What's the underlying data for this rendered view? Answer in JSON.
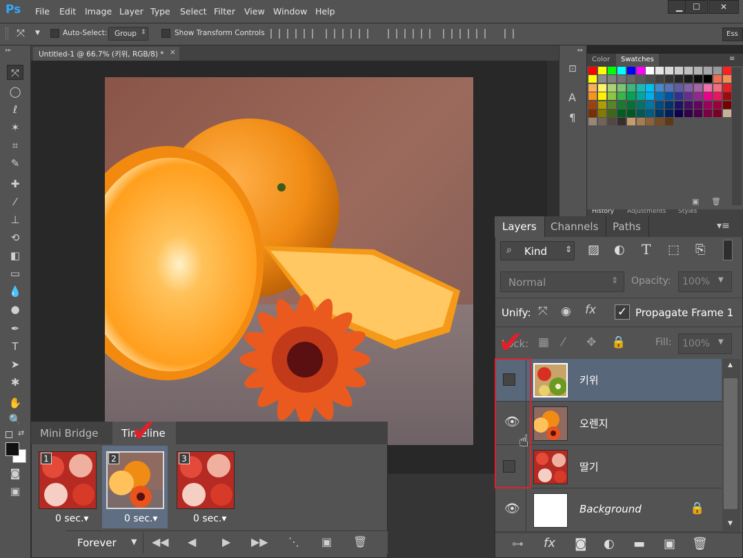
{
  "menubar": {
    "logo": "Ps",
    "items": [
      "File",
      "Edit",
      "Image",
      "Layer",
      "Type",
      "Select",
      "Filter",
      "View",
      "Window",
      "Help"
    ],
    "win_min": "▁",
    "win_max": "☐",
    "win_close": "✕"
  },
  "options": {
    "auto_select_label": "Auto-Select:",
    "auto_select_mode": "Group",
    "show_transform_label": "Show Transform Controls",
    "workspace": "Ess"
  },
  "document": {
    "tab_title": "Untitled-1 @ 66.7% (키위, RGB/8) *",
    "tab_close": "×"
  },
  "swatches": {
    "tabs": [
      "Color",
      "Swatches"
    ],
    "bottom_tabs": [
      "History",
      "Adjustments",
      "Styles"
    ],
    "colors": [
      "#ff0000",
      "#ffff00",
      "#00ff00",
      "#00ffff",
      "#0000ff",
      "#ff00ff",
      "#ffffff",
      "#e6e6e6",
      "#d9d9d9",
      "#cccccc",
      "#bfbfbf",
      "#b3b3b3",
      "#a6a6a6",
      "#999999",
      "#ff1f1f",
      "#ffff00",
      "#8c8c8c",
      "#808080",
      "#737373",
      "#666666",
      "#595959",
      "#4d4d4d",
      "#404040",
      "#333333",
      "#262626",
      "#1a1a1a",
      "#0d0d0d",
      "#000000",
      "#f26c4f",
      "#f68e55",
      "#fbaf5c",
      "#fff467",
      "#acd372",
      "#7cc576",
      "#3bb878",
      "#1abbb4",
      "#00bff3",
      "#438ccb",
      "#5574b9",
      "#605ca8",
      "#855fa8",
      "#a763a9",
      "#f06ea9",
      "#f26d7d",
      "#ed1c24",
      "#f7941d",
      "#fff200",
      "#8dc73f",
      "#39b54a",
      "#00a651",
      "#00a99d",
      "#00aeef",
      "#0072bc",
      "#0054a5",
      "#2e3192",
      "#662d91",
      "#92278f",
      "#ec008c",
      "#ed145b",
      "#9e0b0f",
      "#a0410d",
      "#aba000",
      "#598527",
      "#197b30",
      "#007236",
      "#00746b",
      "#0076a3",
      "#004b80",
      "#003471",
      "#1b1464",
      "#440e62",
      "#630460",
      "#9e005d",
      "#9e0039",
      "#790000",
      "#7b2e00",
      "#827b00",
      "#406618",
      "#005e20",
      "#005826",
      "#005952",
      "#005b7f",
      "#003663",
      "#002157",
      "#0d004c",
      "#32004b",
      "#4b0049",
      "#7b0046",
      "#7a0026",
      "#c7b299",
      "#998675",
      "#736357",
      "#534741",
      "#372f2c",
      "#c69c6e",
      "#a67c52",
      "#8c6239",
      "#754c24",
      "#603813"
    ]
  },
  "layers": {
    "tabs": [
      "Layers",
      "Channels",
      "Paths"
    ],
    "kind_label": "Kind",
    "blend_mode": "Normal",
    "opacity_label": "Opacity:",
    "opacity_value": "100%",
    "unify_label": "Unify:",
    "propagate_label": "Propagate Frame 1",
    "lock_label": "Lock:",
    "fill_label": "Fill:",
    "fill_value": "100%",
    "rows": [
      {
        "name": "키위",
        "visible": false,
        "selected": true
      },
      {
        "name": "오렌지",
        "visible": true,
        "selected": false
      },
      {
        "name": "딸기",
        "visible": false,
        "selected": false
      },
      {
        "name": "Background",
        "visible": true,
        "selected": false
      }
    ]
  },
  "timeline": {
    "tabs": [
      "Mini Bridge",
      "Timeline"
    ],
    "frames": [
      {
        "number": "1",
        "delay": "0 sec.▾"
      },
      {
        "number": "2",
        "delay": "0 sec.▾"
      },
      {
        "number": "3",
        "delay": "0 sec.▾"
      }
    ],
    "loop": "Forever"
  }
}
